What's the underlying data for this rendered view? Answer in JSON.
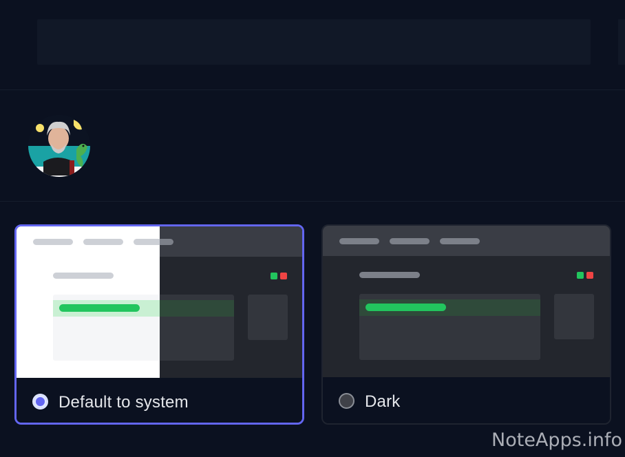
{
  "profile": {
    "name_value": "",
    "name_placeholder": ""
  },
  "avatar": {
    "icon": "user-avatar-photo"
  },
  "themes": {
    "options": [
      {
        "label": "Default to system",
        "selected": true
      },
      {
        "label": "Dark",
        "selected": false
      }
    ],
    "accent_color": "#6366f1",
    "preview_colors": {
      "light_bg": "#ffffff",
      "dark_bg": "#23262d",
      "dark_header": "#3a3d45",
      "green": "#22c55e",
      "red": "#ef4444"
    }
  },
  "watermark": "NoteApps.info"
}
